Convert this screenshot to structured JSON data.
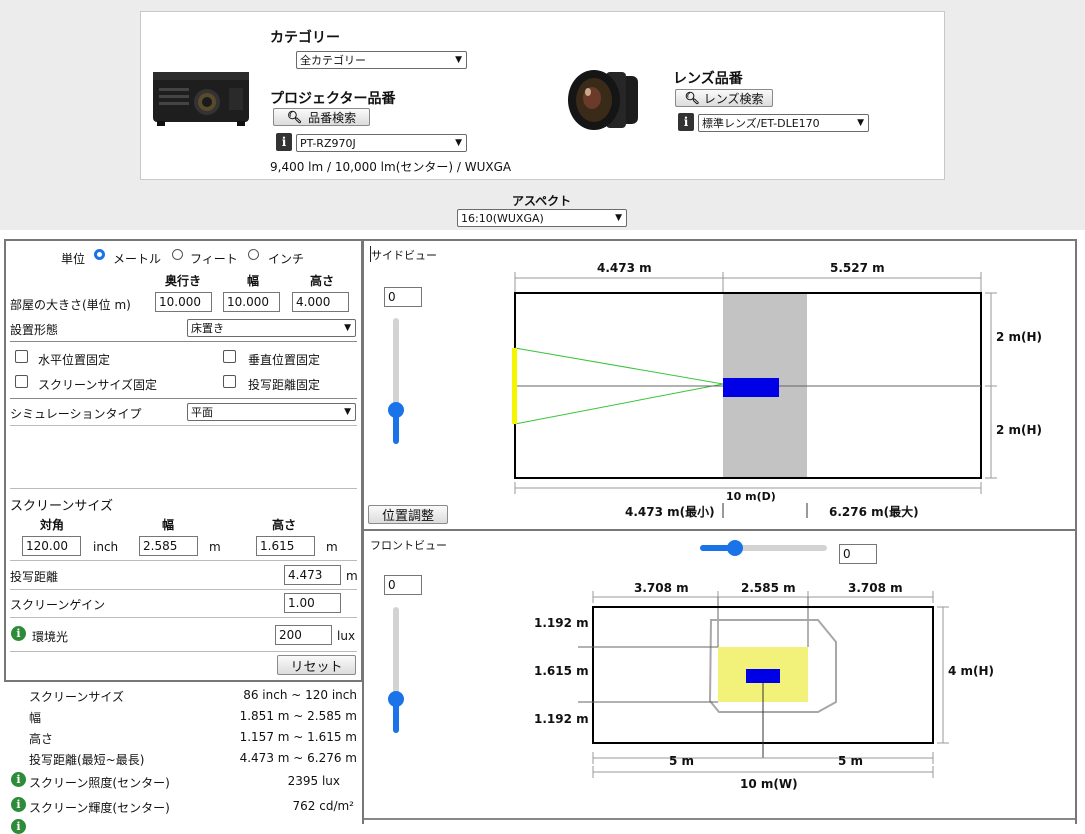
{
  "top": {
    "category_label": "カテゴリー",
    "category_value": "全カテゴリー",
    "projector_label": "プロジェクター品番",
    "model_search_button": "品番検索",
    "projector_value": "PT-RZ970J",
    "projector_specs": "9,400 lm / 10,000 lm(センター) / WUXGA",
    "lens_label": "レンズ品番",
    "lens_search_button": "レンズ検索",
    "lens_value": "標準レンズ/ET-DLE170",
    "aspect_label": "アスペクト",
    "aspect_value": "16:10(WUXGA)"
  },
  "units": {
    "label": "単位",
    "options": [
      "メートル",
      "フィート",
      "インチ"
    ],
    "selected": "メートル"
  },
  "room": {
    "col_depth": "奥行き",
    "col_width": "幅",
    "col_height": "高さ",
    "label": "部屋の大きさ(単位 m)",
    "depth": "10.000",
    "width": "10.000",
    "height": "4.000"
  },
  "installation": {
    "label": "設置形態",
    "value": "床置き"
  },
  "locks": {
    "horizontal": "水平位置固定",
    "vertical": "垂直位置固定",
    "screen_size": "スクリーンサイズ固定",
    "throw": "投写距離固定"
  },
  "simulation": {
    "label": "シミュレーションタイプ",
    "value": "平面"
  },
  "screen": {
    "title": "スクリーンサイズ",
    "col_diag": "対角",
    "col_width": "幅",
    "col_height": "高さ",
    "diag": "120.00",
    "diag_unit": "inch",
    "width": "2.585",
    "width_unit": "m",
    "height": "1.615",
    "height_unit": "m"
  },
  "throw": {
    "label": "投写距離",
    "value": "4.473",
    "unit": "m"
  },
  "gain": {
    "label": "スクリーンゲイン",
    "value": "1.00"
  },
  "ambient": {
    "label": "環境光",
    "value": "200",
    "unit": "lux"
  },
  "reset_button": "リセット",
  "results": [
    {
      "label": "スクリーンサイズ",
      "value": "86 inch ~ 120 inch"
    },
    {
      "label": "幅",
      "value": "1.851 m ~ 2.585 m"
    },
    {
      "label": "高さ",
      "value": "1.157 m ~ 1.615 m"
    },
    {
      "label": "投写距離(最短~最長)",
      "value": "4.473 m ~ 6.276 m"
    },
    {
      "label": "スクリーン照度(センター)",
      "value": "2395 lux"
    },
    {
      "label": "スクリーン輝度(センター)",
      "value": "762 cd/m²"
    }
  ],
  "side_view": {
    "title": "サイドビュー",
    "offset_value": "0",
    "left_dist": "4.473 m",
    "right_dist": "5.527 m",
    "upper_h": "2 m(H)",
    "lower_h": "2 m(H)",
    "depth": "10 m(D)",
    "min": "4.473 m(最小)",
    "max": "6.276 m(最大)",
    "position_button": "位置調整"
  },
  "front_view": {
    "title": "フロントビュー",
    "h_offset_value": "0",
    "v_offset_value": "0",
    "left_w": "3.708 m",
    "screen_w": "2.585 m",
    "right_w": "3.708 m",
    "top_h": "1.192 m",
    "screen_h": "1.615 m",
    "bottom_h": "1.192 m",
    "room_h": "4 m(H)",
    "half_left": "5 m",
    "half_right": "5 m",
    "room_w": "10 m(W)"
  },
  "colors": {
    "accent": "#1a73e8",
    "beam": "#2ecc2e",
    "screen_yellow": "#f5f500",
    "projector_blue": "#0000e6",
    "info_green": "#2e8b3a"
  }
}
